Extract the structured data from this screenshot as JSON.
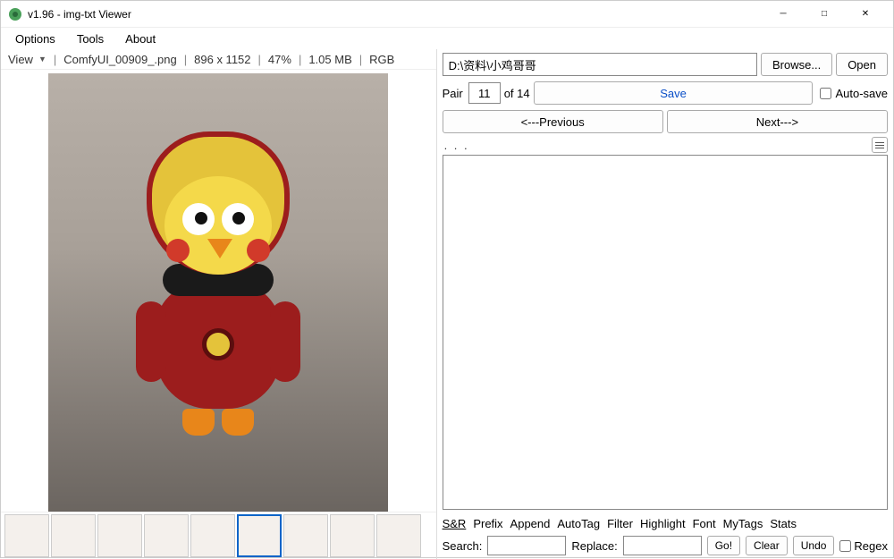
{
  "window": {
    "title": "v1.96 - img-txt Viewer"
  },
  "menu": {
    "options": "Options",
    "tools": "Tools",
    "about": "About"
  },
  "viewbar": {
    "view": "View",
    "filename": "ComfyUI_00909_.png",
    "dimensions": "896 x 1152",
    "zoom": "47%",
    "filesize": "1.05 MB",
    "colormode": "RGB"
  },
  "path": {
    "value": "D:\\资料\\小鸡哥哥",
    "browse": "Browse...",
    "open": "Open"
  },
  "pair": {
    "label": "Pair",
    "index": "11",
    "of": "of 14",
    "save": "Save",
    "autosave": "Auto-save"
  },
  "nav": {
    "prev": "<---Previous",
    "next": "Next--->"
  },
  "ellipsis": ". . .",
  "tabs": {
    "sr": "S&R",
    "prefix": "Prefix",
    "append": "Append",
    "autotag": "AutoTag",
    "filter": "Filter",
    "highlight": "Highlight",
    "font": "Font",
    "mytags": "MyTags",
    "stats": "Stats"
  },
  "search": {
    "searchlabel": "Search:",
    "replacelabel": "Replace:",
    "go": "Go!",
    "clear": "Clear",
    "undo": "Undo",
    "regex": "Regex"
  }
}
